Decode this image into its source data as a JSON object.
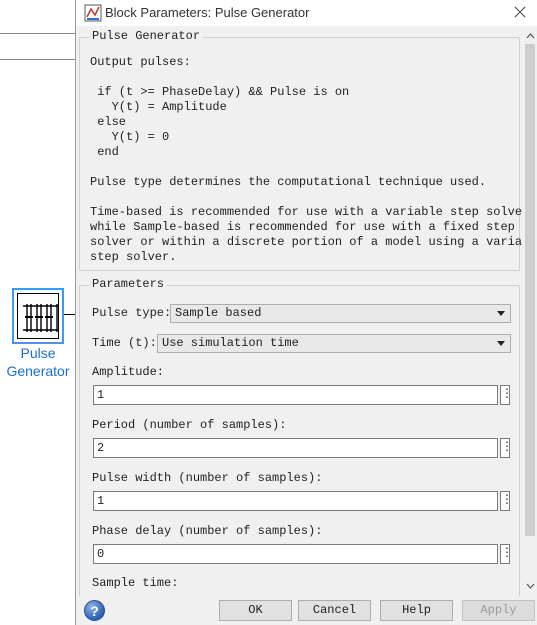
{
  "background": {
    "block_label_line1": "Pulse",
    "block_label_line2": "Generator",
    "block_icon": "pulse-generator-block-icon"
  },
  "dialog": {
    "title": "Block Parameters: Pulse Generator",
    "title_icon": "simulink-block-icon",
    "close_icon": "close-icon"
  },
  "description": {
    "group_title": "Pulse Generator",
    "text": "Output pulses:\n\n if (t >= PhaseDelay) && Pulse is on\n   Y(t) = Amplitude\n else\n   Y(t) = 0\n end\n\nPulse type determines the computational technique used.\n\nTime-based is recommended for use with a variable step solver,\nwhile Sample-based is recommended for use with a fixed step\nsolver or within a discrete portion of a model using a variable\nstep solver."
  },
  "parameters": {
    "group_title": "Parameters",
    "pulse_type_label": "Pulse type:",
    "pulse_type_value": "Sample based",
    "time_label": "Time (t):",
    "time_value": "Use simulation time",
    "amplitude_label": "Amplitude:",
    "amplitude_value": "1",
    "period_label": "Period (number of samples):",
    "period_value": "2",
    "pulse_width_label": "Pulse width (number of samples):",
    "pulse_width_value": "1",
    "phase_delay_label": "Phase delay (number of samples):",
    "phase_delay_value": "0",
    "sample_time_label": "Sample time:",
    "dots_label": "⋮"
  },
  "buttons": {
    "help_icon": "?",
    "ok": "OK",
    "cancel": "Cancel",
    "help": "Help",
    "apply": "Apply"
  },
  "colors": {
    "block_highlight": "#3c9bf0",
    "block_label": "#1a6fd8",
    "dialog_bg": "#f0f0f0"
  }
}
